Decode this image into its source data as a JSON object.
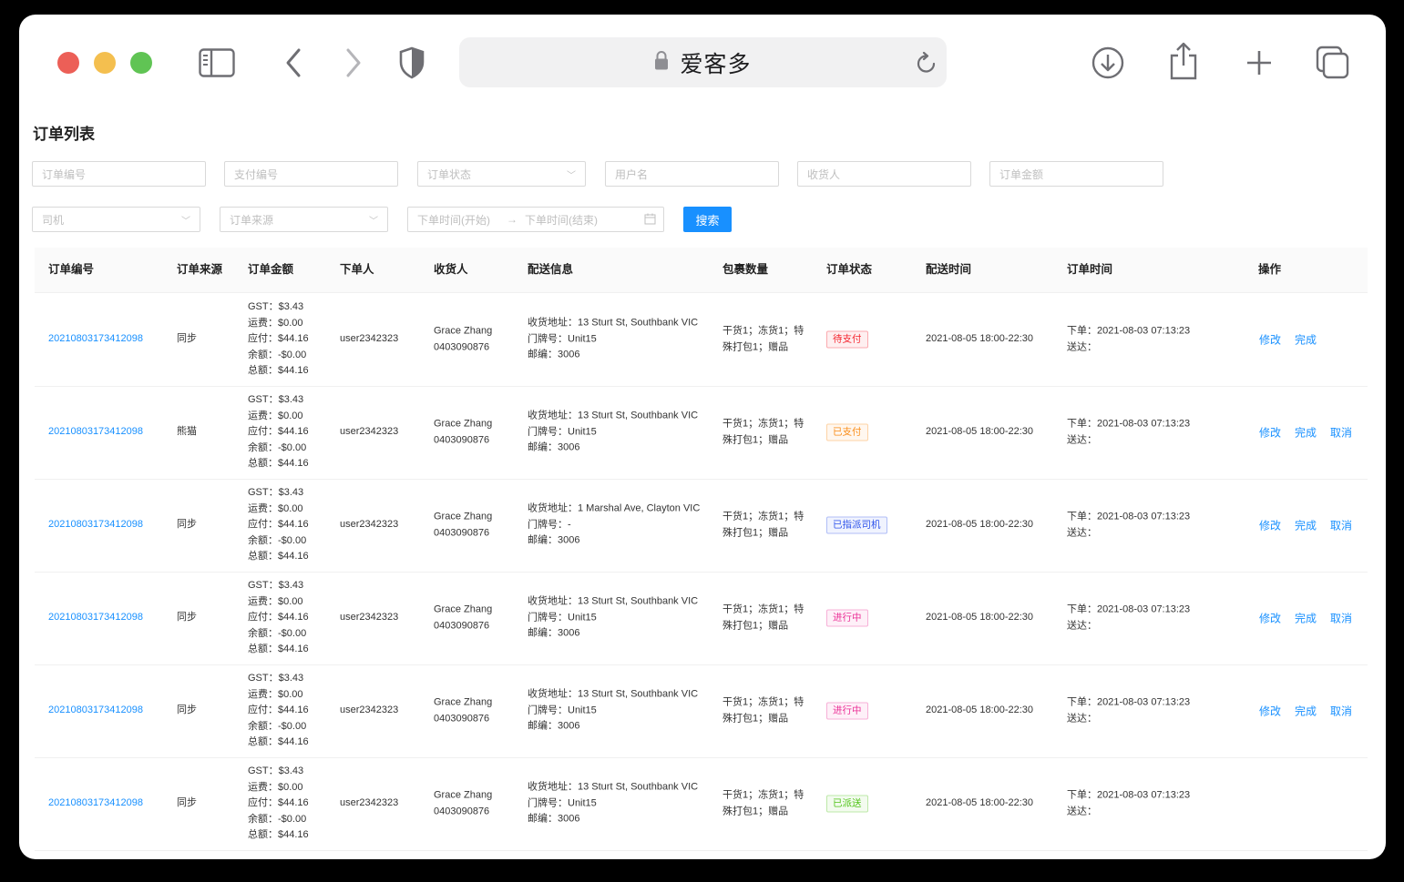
{
  "browser": {
    "url_title": "爱客多",
    "colors": {
      "close": "#ec5f57",
      "minimize": "#f4bf4f",
      "maximize": "#60c454"
    }
  },
  "page": {
    "title": "订单列表",
    "filters": {
      "order_no": "订单编号",
      "pay_no": "支付编号",
      "order_status": "订单状态",
      "username": "用户名",
      "receiver": "收货人",
      "amount": "订单金额",
      "driver": "司机",
      "source": "订单来源",
      "time_start": "下单时间(开始)",
      "time_end": "下单时间(结束)",
      "search": "搜索"
    },
    "table": {
      "headers": [
        "订单编号",
        "订单来源",
        "订单金额",
        "下单人",
        "收货人",
        "配送信息",
        "包裹数量",
        "订单状态",
        "配送时间",
        "订单时间",
        "操作"
      ],
      "rows": [
        {
          "order_no": "20210803173412098",
          "source": "同步",
          "gst": "GST：$3.43",
          "shipping": "运费：$0.00",
          "payable": "应付：$44.16",
          "balance": "余额：-$0.00",
          "total": "总额：$44.16",
          "user": "user2342323",
          "recv_name": "Grace Zhang",
          "recv_phone": "0403090876",
          "addr": "收货地址：13 Sturt St, Southbank VIC",
          "unit": "门牌号：Unit15",
          "postcode": "邮编：3006",
          "pkg1": "干货1；冻货1；特",
          "pkg2": "殊打包1；赠品",
          "status": "待支付",
          "status_color": "#f5222d",
          "delivery": "2021-08-05 18:00-22:30",
          "placed": "下单：2021-08-03 07:13:23",
          "sent": "送达：",
          "ops": [
            "修改",
            "完成"
          ]
        },
        {
          "order_no": "20210803173412098",
          "source": "熊猫",
          "gst": "GST：$3.43",
          "shipping": "运费：$0.00",
          "payable": "应付：$44.16",
          "balance": "余额：-$0.00",
          "total": "总额：$44.16",
          "user": "user2342323",
          "recv_name": "Grace Zhang",
          "recv_phone": "0403090876",
          "addr": "收货地址：13 Sturt St, Southbank VIC",
          "unit": "门牌号：Unit15",
          "postcode": "邮编：3006",
          "pkg1": "干货1；冻货1；特",
          "pkg2": "殊打包1；赠品",
          "status": "已支付",
          "status_color": "#fa8c16",
          "delivery": "2021-08-05 18:00-22:30",
          "placed": "下单：2021-08-03 07:13:23",
          "sent": "送达：",
          "ops": [
            "修改",
            "完成",
            "取消"
          ]
        },
        {
          "order_no": "20210803173412098",
          "source": "同步",
          "gst": "GST：$3.43",
          "shipping": "运费：$0.00",
          "payable": "应付：$44.16",
          "balance": "余额：-$0.00",
          "total": "总额：$44.16",
          "user": "user2342323",
          "recv_name": "Grace Zhang",
          "recv_phone": "0403090876",
          "addr": "收货地址：1 Marshal Ave, Clayton VIC",
          "unit": "门牌号：-",
          "postcode": "邮编：3006",
          "pkg1": "干货1；冻货1；特",
          "pkg2": "殊打包1；赠品",
          "status": "已指派司机",
          "status_color": "#2f54eb",
          "delivery": "2021-08-05 18:00-22:30",
          "placed": "下单：2021-08-03 07:13:23",
          "sent": "送达：",
          "ops": [
            "修改",
            "完成",
            "取消"
          ]
        },
        {
          "order_no": "20210803173412098",
          "source": "同步",
          "gst": "GST：$3.43",
          "shipping": "运费：$0.00",
          "payable": "应付：$44.16",
          "balance": "余额：-$0.00",
          "total": "总额：$44.16",
          "user": "user2342323",
          "recv_name": "Grace Zhang",
          "recv_phone": "0403090876",
          "addr": "收货地址：13 Sturt St, Southbank VIC",
          "unit": "门牌号：Unit15",
          "postcode": "邮编：3006",
          "pkg1": "干货1；冻货1；特",
          "pkg2": "殊打包1；赠品",
          "status": "进行中",
          "status_color": "#eb2f96",
          "delivery": "2021-08-05 18:00-22:30",
          "placed": "下单：2021-08-03 07:13:23",
          "sent": "送达：",
          "ops": [
            "修改",
            "完成",
            "取消"
          ]
        },
        {
          "order_no": "20210803173412098",
          "source": "同步",
          "gst": "GST：$3.43",
          "shipping": "运费：$0.00",
          "payable": "应付：$44.16",
          "balance": "余额：-$0.00",
          "total": "总额：$44.16",
          "user": "user2342323",
          "recv_name": "Grace Zhang",
          "recv_phone": "0403090876",
          "addr": "收货地址：13 Sturt St, Southbank VIC",
          "unit": "门牌号：Unit15",
          "postcode": "邮编：3006",
          "pkg1": "干货1；冻货1；特",
          "pkg2": "殊打包1；赠品",
          "status": "进行中",
          "status_color": "#eb2f96",
          "delivery": "2021-08-05 18:00-22:30",
          "placed": "下单：2021-08-03 07:13:23",
          "sent": "送达：",
          "ops": [
            "修改",
            "完成",
            "取消"
          ]
        },
        {
          "order_no": "20210803173412098",
          "source": "同步",
          "gst": "GST：$3.43",
          "shipping": "运费：$0.00",
          "payable": "应付：$44.16",
          "balance": "余额：-$0.00",
          "total": "总额：$44.16",
          "user": "user2342323",
          "recv_name": "Grace Zhang",
          "recv_phone": "0403090876",
          "addr": "收货地址：13 Sturt St, Southbank VIC",
          "unit": "门牌号：Unit15",
          "postcode": "邮编：3006",
          "pkg1": "干货1；冻货1；特",
          "pkg2": "殊打包1；赠品",
          "status": "已派送",
          "status_color": "#52c41a",
          "delivery": "2021-08-05 18:00-22:30",
          "placed": "下单：2021-08-03 07:13:23",
          "sent": "送达：",
          "ops": []
        }
      ]
    }
  }
}
